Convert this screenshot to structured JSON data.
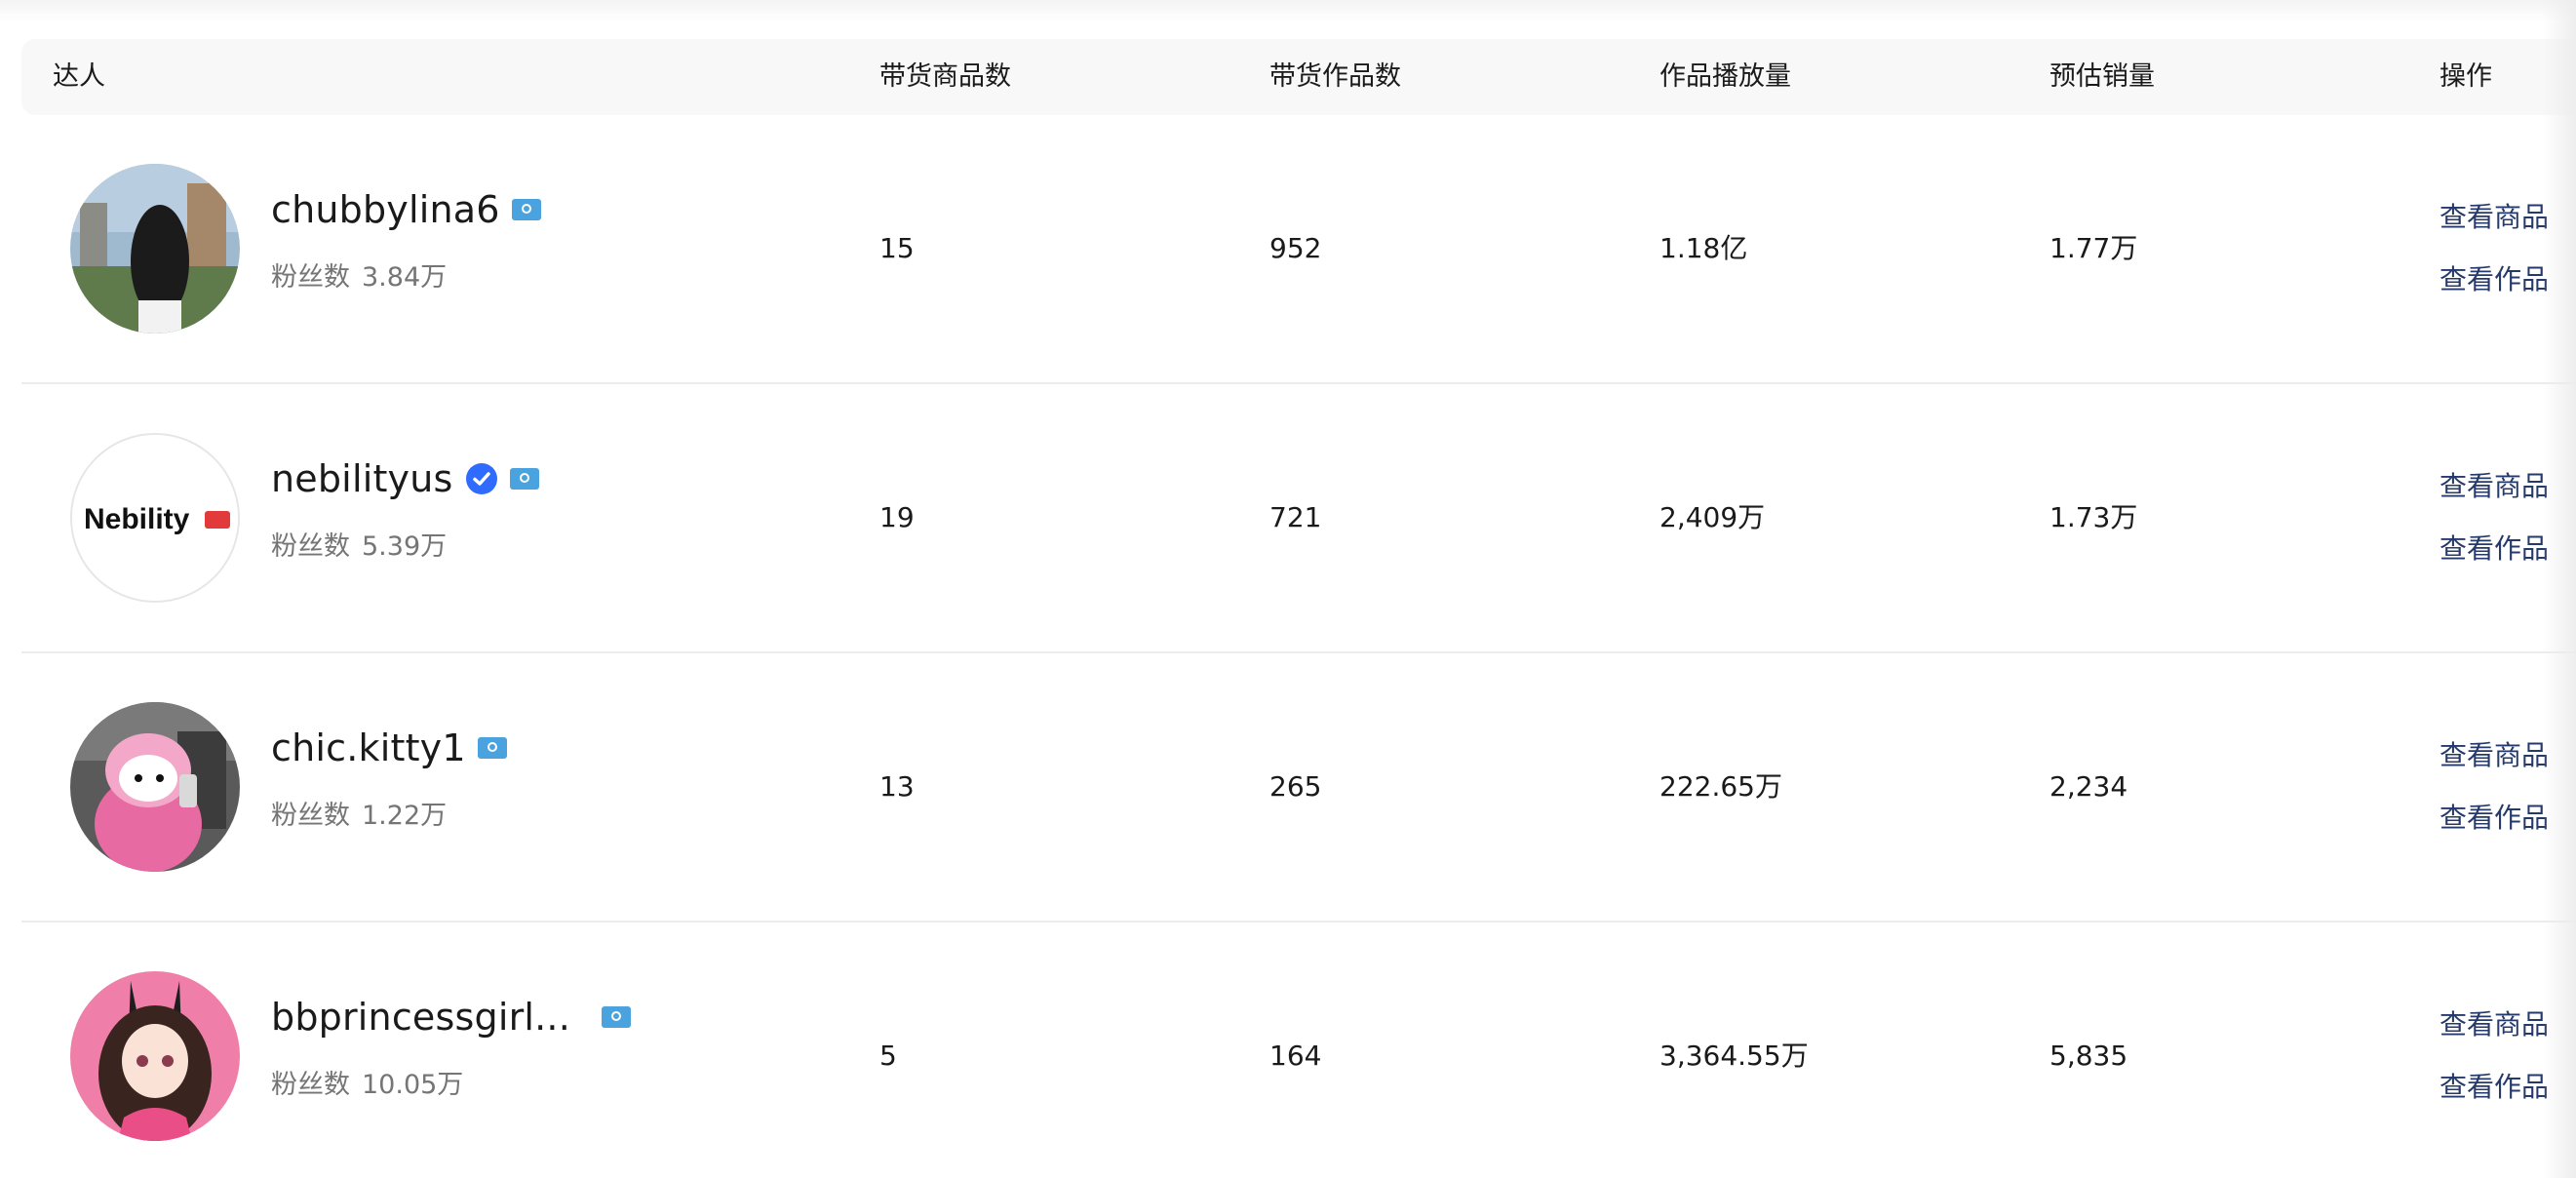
{
  "table": {
    "headers": {
      "talent": "达人",
      "products": "带货商品数",
      "videos": "带货作品数",
      "plays": "作品播放量",
      "sales": "预估销量",
      "actions": "操作"
    },
    "fans_label": "粉丝数",
    "action_view_products": "查看商品",
    "action_view_videos": "查看作品",
    "rows": [
      {
        "name": "chubbylina6",
        "verified": false,
        "fans": "3.84万",
        "products": "15",
        "videos": "952",
        "plays": "1.18亿",
        "sales": "1.77万",
        "avatar_icon": "avatar-photo-woman-back-icon"
      },
      {
        "name": "nebilityus",
        "verified": true,
        "fans": "5.39万",
        "products": "19",
        "videos": "721",
        "plays": "2,409万",
        "sales": "1.73万",
        "avatar_text": "Nebility",
        "avatar_icon": "nebility-logo-icon"
      },
      {
        "name": "chic.kitty1",
        "verified": false,
        "fans": "1.22万",
        "products": "13",
        "videos": "265",
        "plays": "222.65万",
        "sales": "2,234",
        "avatar_icon": "avatar-pink-kitty-icon"
      },
      {
        "name": "bbprincessgirl...",
        "verified": false,
        "fans": "10.05万",
        "products": "5",
        "videos": "164",
        "plays": "3,364.55万",
        "sales": "5,835",
        "avatar_icon": "avatar-anime-bunny-girl-icon"
      }
    ]
  },
  "colors": {
    "link": "#253a6b",
    "verified": "#2f6bff",
    "flag": "#4aa3df",
    "header_bg": "#f8f8f8",
    "divider": "#ececec",
    "muted_text": "#757575"
  }
}
